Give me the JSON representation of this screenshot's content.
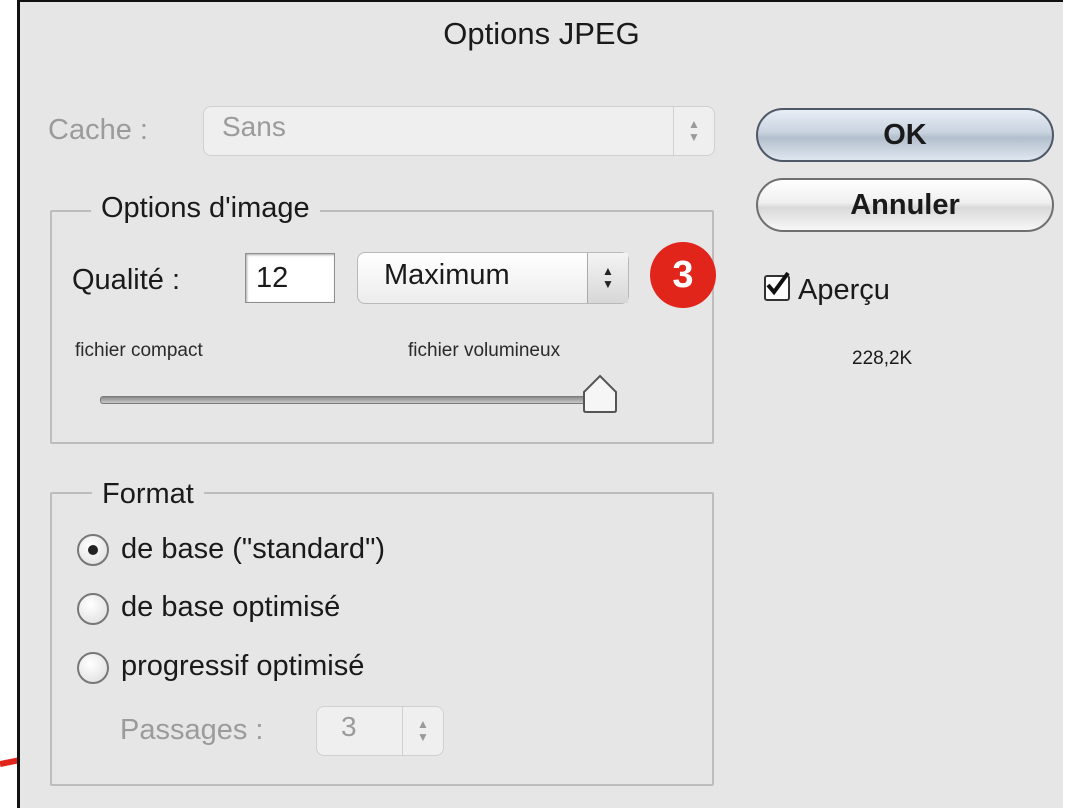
{
  "window": {
    "title": "Options JPEG"
  },
  "cache": {
    "label": "Cache :",
    "value": "Sans"
  },
  "image_options": {
    "legend": "Options d'image",
    "quality_label": "Qualité :",
    "quality_value": "12",
    "quality_preset": "Maximum",
    "slider_min_label": "fichier compact",
    "slider_max_label": "fichier volumineux",
    "slider_fraction": 1.0
  },
  "buttons": {
    "ok": "OK",
    "cancel": "Annuler"
  },
  "preview": {
    "label": "Aperçu",
    "checked": true,
    "size": "228,2K"
  },
  "badge": {
    "text": "3",
    "color": "#e2251b"
  },
  "format": {
    "legend": "Format",
    "options": [
      {
        "label": "de base  (\"standard\")",
        "selected": true
      },
      {
        "label": "de base optimisé",
        "selected": false
      },
      {
        "label": "progressif optimisé",
        "selected": false
      }
    ],
    "passes_label": "Passages :",
    "passes_value": "3"
  },
  "annotation_arrow": {
    "color": "#e2251b"
  }
}
